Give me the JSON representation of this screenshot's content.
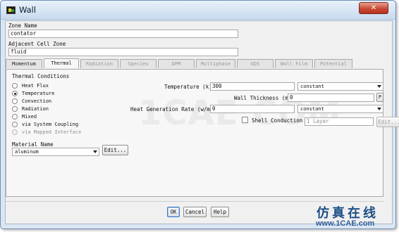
{
  "window": {
    "title": "Wall",
    "close_glyph": "✕"
  },
  "zone": {
    "name_label": "Zone Name",
    "name_value": "contator"
  },
  "adjacent": {
    "label": "Adjacent Cell Zone",
    "value": "fluid"
  },
  "tabs": [
    {
      "label": "Momentum",
      "enabled": true
    },
    {
      "label": "Thermal",
      "active": true,
      "enabled": true
    },
    {
      "label": "Radiation",
      "enabled": false
    },
    {
      "label": "Species",
      "enabled": false
    },
    {
      "label": "DPM",
      "enabled": false
    },
    {
      "label": "Multiphase",
      "enabled": false
    },
    {
      "label": "UDS",
      "enabled": false
    },
    {
      "label": "Wall Film",
      "enabled": false
    },
    {
      "label": "Potential",
      "enabled": false
    }
  ],
  "thermal": {
    "conditions_title": "Thermal Conditions",
    "options": [
      {
        "label": "Heat Flux",
        "checked": false,
        "enabled": true
      },
      {
        "label": "Temperature",
        "checked": true,
        "enabled": true
      },
      {
        "label": "Convection",
        "checked": false,
        "enabled": true
      },
      {
        "label": "Radiation",
        "checked": false,
        "enabled": true
      },
      {
        "label": "Mixed",
        "checked": false,
        "enabled": true
      },
      {
        "label": "via System Coupling",
        "checked": false,
        "enabled": true
      },
      {
        "label": "via Mapped Interface",
        "checked": false,
        "enabled": false
      }
    ],
    "temperature": {
      "label": "Temperature (k)",
      "value": "300",
      "method": "constant"
    },
    "wall_thickness": {
      "label": "Wall Thickness (m)",
      "value": "0",
      "param_button": "P"
    },
    "heat_gen": {
      "label": "Heat Generation Rate (w/m3)",
      "value": "0",
      "method": "constant"
    },
    "shell_conduction": {
      "label": "Shell Conduction",
      "checked": false,
      "layers": "1 Layer",
      "edit_label": "Edit..."
    },
    "material": {
      "label": "Material Name",
      "value": "aluminum",
      "edit_label": "Edit..."
    }
  },
  "buttons": {
    "ok": "OK",
    "cancel": "Cancel",
    "help": "Help"
  },
  "watermark": {
    "text": "1CAE.COM",
    "cn": "仿真在线",
    "url": "www.1CAE.com"
  },
  "colors": {
    "title_bar": "#c9daee",
    "close_button": "#c94a36",
    "accent_blue": "#1c4f86"
  }
}
